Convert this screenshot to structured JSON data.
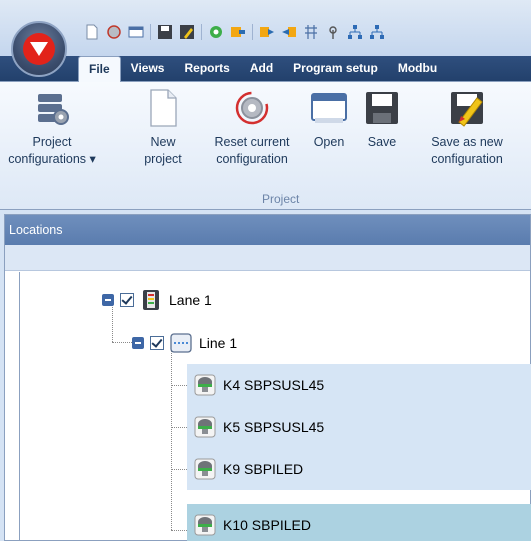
{
  "tabs": [
    {
      "label": "File",
      "active": true
    },
    {
      "label": "Views",
      "active": false
    },
    {
      "label": "Reports",
      "active": false
    },
    {
      "label": "Add",
      "active": false
    },
    {
      "label": "Program setup",
      "active": false
    },
    {
      "label": "Modbu",
      "active": false
    }
  ],
  "ribbon": {
    "buttons": [
      {
        "line1": "Project",
        "line2": "configurations ▾",
        "icon": "project-configurations-icon"
      },
      {
        "line1": "New",
        "line2": "project",
        "icon": "new-project-icon"
      },
      {
        "line1": "Reset current",
        "line2": "configuration",
        "icon": "reset-configuration-icon"
      },
      {
        "line1": "Open",
        "line2": "",
        "icon": "open-icon"
      },
      {
        "line1": "Save",
        "line2": "",
        "icon": "save-icon"
      },
      {
        "line1": "Save as new",
        "line2": "configuration",
        "icon": "save-as-new-icon"
      }
    ],
    "group_label": "Project"
  },
  "locations": {
    "title": "Locations",
    "tree": [
      {
        "label": "Lane 1",
        "level": 0,
        "checked": true,
        "expanded": true,
        "icon": "lane-icon"
      },
      {
        "label": "Line 1",
        "level": 1,
        "checked": true,
        "expanded": true,
        "icon": "line-icon"
      },
      {
        "label": "K4 SBPSUSL45",
        "level": 2,
        "icon": "sensor-icon"
      },
      {
        "label": "K5 SBPSUSL45",
        "level": 2,
        "icon": "sensor-icon"
      },
      {
        "label": "K9 SBPILED",
        "level": 2,
        "icon": "sensor-icon"
      },
      {
        "label": "K10 SBPILED",
        "level": 2,
        "icon": "sensor-icon",
        "selected": true
      }
    ]
  },
  "colors": {
    "tabstrip": "#2f4f7e",
    "brand_red": "#e2231a",
    "selection": "#acd2e1",
    "highlight": "#d6e5f5"
  }
}
